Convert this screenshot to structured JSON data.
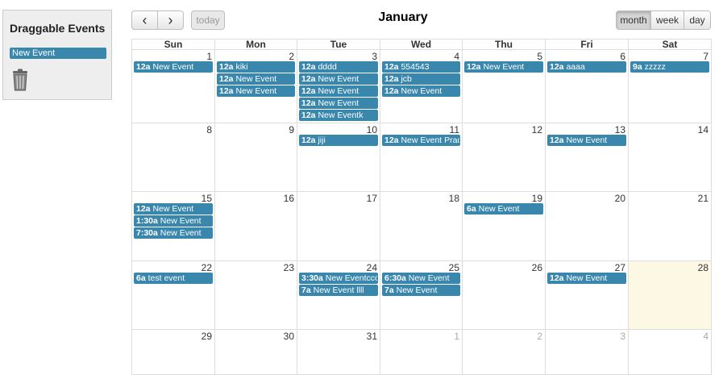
{
  "sidebar": {
    "title": "Draggable Events",
    "drag_event_label": "New Event"
  },
  "toolbar": {
    "prev_icon": "‹",
    "next_icon": "›",
    "today_label": "today",
    "month_label": "month",
    "week_label": "week",
    "day_label": "day",
    "title": "January"
  },
  "weekdays": [
    "Sun",
    "Mon",
    "Tue",
    "Wed",
    "Thu",
    "Fri",
    "Sat"
  ],
  "weeks": [
    [
      {
        "day": "1",
        "other": false,
        "events": [
          {
            "time": "12a",
            "title": "New Event"
          }
        ]
      },
      {
        "day": "2",
        "other": false,
        "events": [
          {
            "time": "12a",
            "title": "kiki"
          },
          {
            "time": "12a",
            "title": "New Event"
          },
          {
            "time": "12a",
            "title": "New Event"
          }
        ]
      },
      {
        "day": "3",
        "other": false,
        "events": [
          {
            "time": "12a",
            "title": "dddd"
          },
          {
            "time": "12a",
            "title": "New Event"
          },
          {
            "time": "12a",
            "title": "New Event"
          },
          {
            "time": "12a",
            "title": "New Event"
          },
          {
            "time": "12a",
            "title": "New Eventk"
          }
        ]
      },
      {
        "day": "4",
        "other": false,
        "events": [
          {
            "time": "12a",
            "title": "554543"
          },
          {
            "time": "12a",
            "title": "jcb"
          },
          {
            "time": "12a",
            "title": "New Event"
          }
        ]
      },
      {
        "day": "5",
        "other": false,
        "events": [
          {
            "time": "12a",
            "title": "New Event"
          }
        ]
      },
      {
        "day": "6",
        "other": false,
        "events": [
          {
            "time": "12a",
            "title": "aaaa"
          }
        ]
      },
      {
        "day": "7",
        "other": false,
        "events": [
          {
            "time": "9a",
            "title": "zzzzz"
          }
        ]
      }
    ],
    [
      {
        "day": "8",
        "other": false,
        "events": []
      },
      {
        "day": "9",
        "other": false,
        "events": []
      },
      {
        "day": "10",
        "other": false,
        "events": [
          {
            "time": "12a",
            "title": "jiji"
          }
        ]
      },
      {
        "day": "11",
        "other": false,
        "events": [
          {
            "time": "12a",
            "title": "New Event Pradee"
          }
        ]
      },
      {
        "day": "12",
        "other": false,
        "events": []
      },
      {
        "day": "13",
        "other": false,
        "events": [
          {
            "time": "12a",
            "title": "New Event"
          }
        ]
      },
      {
        "day": "14",
        "other": false,
        "events": []
      }
    ],
    [
      {
        "day": "15",
        "other": false,
        "events": [
          {
            "time": "12a",
            "title": "New Event"
          },
          {
            "time": "1:30a",
            "title": "New Event"
          },
          {
            "time": "7:30a",
            "title": "New Event"
          }
        ]
      },
      {
        "day": "16",
        "other": false,
        "events": []
      },
      {
        "day": "17",
        "other": false,
        "events": []
      },
      {
        "day": "18",
        "other": false,
        "events": []
      },
      {
        "day": "19",
        "other": false,
        "events": [
          {
            "time": "6a",
            "title": "New Event"
          }
        ]
      },
      {
        "day": "20",
        "other": false,
        "events": []
      },
      {
        "day": "21",
        "other": false,
        "events": []
      }
    ],
    [
      {
        "day": "22",
        "other": false,
        "events": [
          {
            "time": "6a",
            "title": "test event"
          }
        ]
      },
      {
        "day": "23",
        "other": false,
        "events": []
      },
      {
        "day": "24",
        "other": false,
        "events": [
          {
            "time": "3:30a",
            "title": "New Eventcccccc"
          },
          {
            "time": "7a",
            "title": "New Event llll"
          }
        ]
      },
      {
        "day": "25",
        "other": false,
        "events": [
          {
            "time": "6:30a",
            "title": "New Event"
          },
          {
            "time": "7a",
            "title": "New Event"
          }
        ]
      },
      {
        "day": "26",
        "other": false,
        "events": []
      },
      {
        "day": "27",
        "other": false,
        "events": [
          {
            "time": "12a",
            "title": "New Event"
          }
        ]
      },
      {
        "day": "28",
        "other": false,
        "today": true,
        "events": []
      }
    ],
    [
      {
        "day": "29",
        "other": false,
        "events": []
      },
      {
        "day": "30",
        "other": false,
        "events": []
      },
      {
        "day": "31",
        "other": false,
        "events": []
      },
      {
        "day": "1",
        "other": true,
        "events": []
      },
      {
        "day": "2",
        "other": true,
        "events": []
      },
      {
        "day": "3",
        "other": true,
        "events": []
      },
      {
        "day": "4",
        "other": true,
        "events": []
      }
    ]
  ],
  "colors": {
    "event": "#3a87ad",
    "today_bg": "#fcf8e3",
    "border": "#dddddd"
  }
}
